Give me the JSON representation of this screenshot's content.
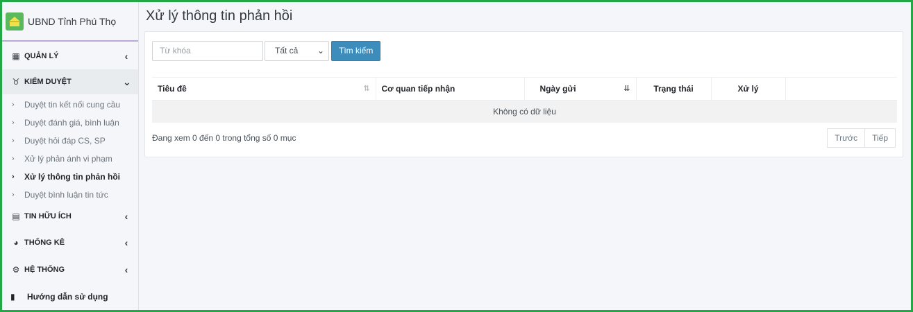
{
  "brand": {
    "name": "UBND Tỉnh Phú Thọ"
  },
  "sidebar": {
    "sections": [
      {
        "label": "QUẢN LÝ",
        "icon": "book-icon"
      },
      {
        "label": "KIỂM DUYỆT",
        "icon": "medal-icon"
      },
      {
        "label": "TIN HỮU ÍCH",
        "icon": "newspaper-icon"
      },
      {
        "label": "THỐNG KÊ",
        "icon": "pie-chart-icon"
      },
      {
        "label": "HỆ THỐNG",
        "icon": "gears-icon"
      }
    ],
    "kiem_duyet_items": [
      "Duyệt tin kết nối cung cầu",
      "Duyệt đánh giá, bình luận",
      "Duyệt hỏi đáp CS, SP",
      "Xử lý phản ánh vi phạm",
      "Xử lý thông tin phản hồi",
      "Duyệt bình luận tin tức"
    ],
    "active_item": "Xử lý thông tin phản hồi",
    "help": "Hướng dẫn sử dụng"
  },
  "page": {
    "title": "Xử lý thông tin phản hồi"
  },
  "filters": {
    "keyword_placeholder": "Từ khóa",
    "status_selected": "Tất cả",
    "search_label": "Tìm kiếm"
  },
  "table": {
    "columns": [
      "Tiêu đề",
      "Cơ quan tiếp nhận",
      "Ngày gửi",
      "Trạng thái",
      "Xử lý"
    ],
    "empty_text": "Không có dữ liệu"
  },
  "footer": {
    "info": "Đang xem 0 đến 0 trong tổng số 0 mục",
    "prev": "Trước",
    "next": "Tiếp"
  },
  "colors": {
    "primary": "#3c8dbc",
    "frame": "#22a845"
  }
}
